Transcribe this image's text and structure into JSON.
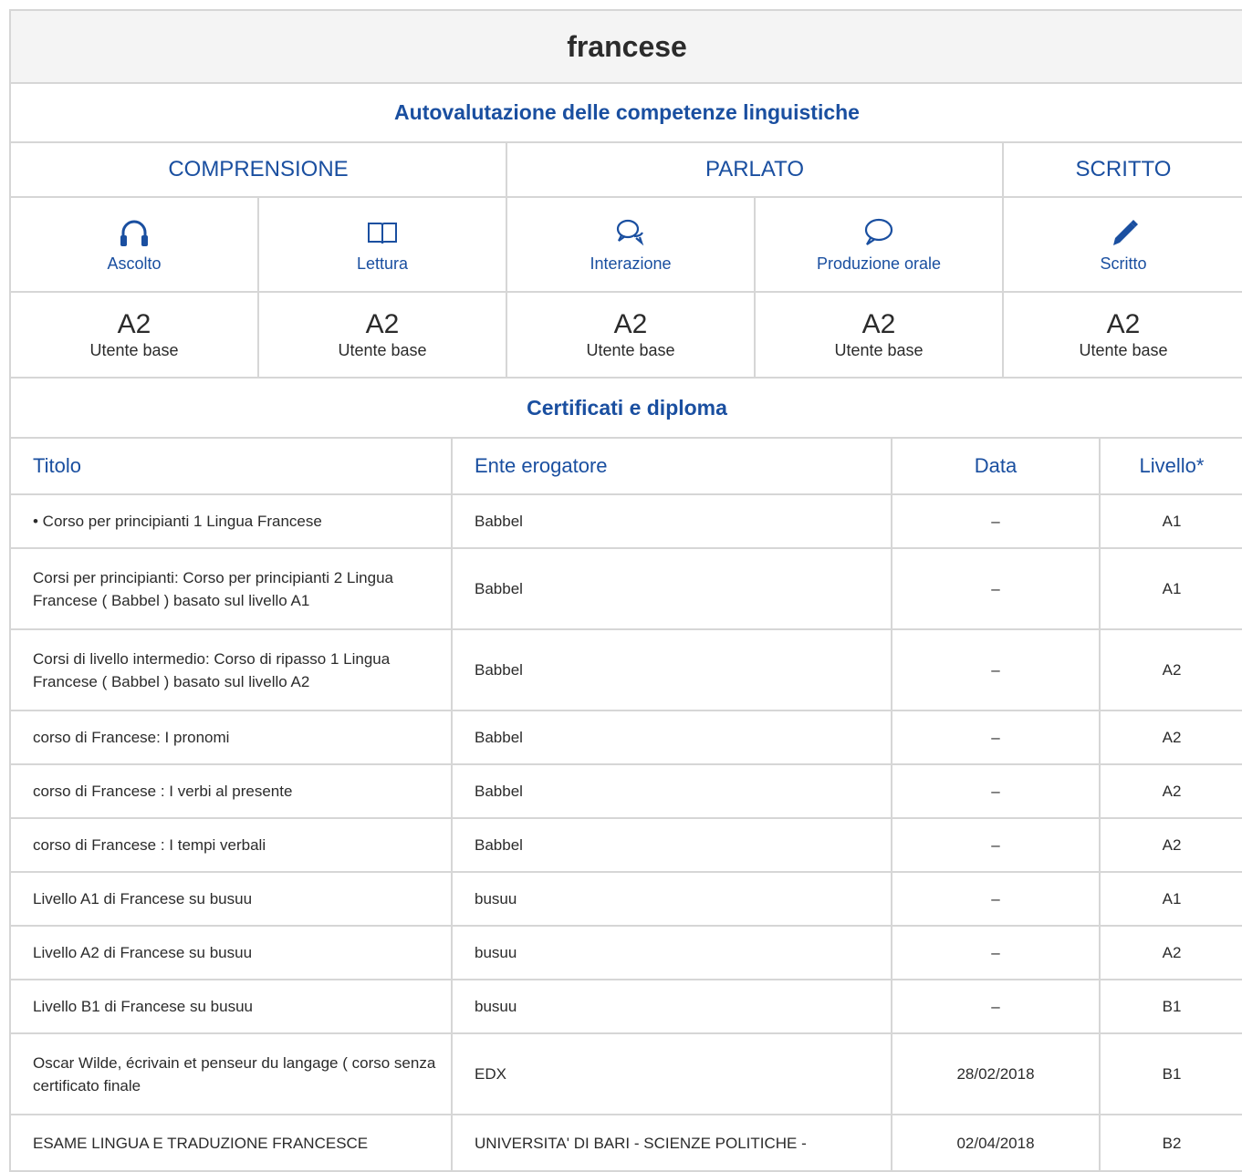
{
  "language": "francese",
  "self_assessment": {
    "heading": "Autovalutazione delle competenze linguistiche",
    "groups": [
      "COMPRENSIONE",
      "PARLATO",
      "SCRITTO"
    ],
    "skills": [
      {
        "label": "Ascolto",
        "icon": "headphones-icon",
        "level": "A2",
        "level_desc": "Utente base"
      },
      {
        "label": "Lettura",
        "icon": "open-book-icon",
        "level": "A2",
        "level_desc": "Utente base"
      },
      {
        "label": "Interazione",
        "icon": "chat-bubbles-icon",
        "level": "A2",
        "level_desc": "Utente base"
      },
      {
        "label": "Produzione orale",
        "icon": "speech-bubble-icon",
        "level": "A2",
        "level_desc": "Utente base"
      },
      {
        "label": "Scritto",
        "icon": "pencil-icon",
        "level": "A2",
        "level_desc": "Utente base"
      }
    ]
  },
  "certificates": {
    "heading": "Certificati e diploma",
    "columns": [
      "Titolo",
      "Ente erogatore",
      "Data",
      "Livello*"
    ],
    "rows": [
      {
        "title": "• Corso per principianti 1 Lingua Francese",
        "issuer": "Babbel",
        "date": "–",
        "level": "A1"
      },
      {
        "title": "Corsi per principianti: Corso per principianti 2 Lingua Francese ( Babbel ) basato sul livello A1",
        "issuer": "Babbel",
        "date": "–",
        "level": "A1"
      },
      {
        "title": "Corsi di livello intermedio: Corso di ripasso 1 Lingua Francese ( Babbel ) basato sul livello A2",
        "issuer": "Babbel",
        "date": "–",
        "level": "A2"
      },
      {
        "title": "corso di Francese: I pronomi",
        "issuer": "Babbel",
        "date": "–",
        "level": "A2"
      },
      {
        "title": "corso di Francese : I verbi al presente",
        "issuer": "Babbel",
        "date": "–",
        "level": "A2"
      },
      {
        "title": "corso di Francese : I tempi verbali",
        "issuer": "Babbel",
        "date": "–",
        "level": "A2"
      },
      {
        "title": "Livello A1 di Francese su busuu",
        "issuer": "busuu",
        "date": "–",
        "level": "A1"
      },
      {
        "title": "Livello A2 di Francese su busuu",
        "issuer": "busuu",
        "date": "–",
        "level": "A2"
      },
      {
        "title": "Livello B1 di Francese su busuu",
        "issuer": "busuu",
        "date": "–",
        "level": "B1"
      },
      {
        "title": "Oscar Wilde, écrivain et penseur du langage ( corso senza certificato finale",
        "issuer": "EDX",
        "date": "28/02/2018",
        "level": "B1"
      },
      {
        "title": "ESAME LINGUA E TRADUZIONE FRANCESCE",
        "issuer": "UNIVERSITA' DI BARI - SCIENZE POLITICHE -",
        "date": "02/04/2018",
        "level": "B2"
      }
    ]
  },
  "colors": {
    "accent": "#1a4fa0",
    "border": "#d6d6d6",
    "title_bg": "#f4f4f4",
    "text": "#2b2b2b"
  }
}
